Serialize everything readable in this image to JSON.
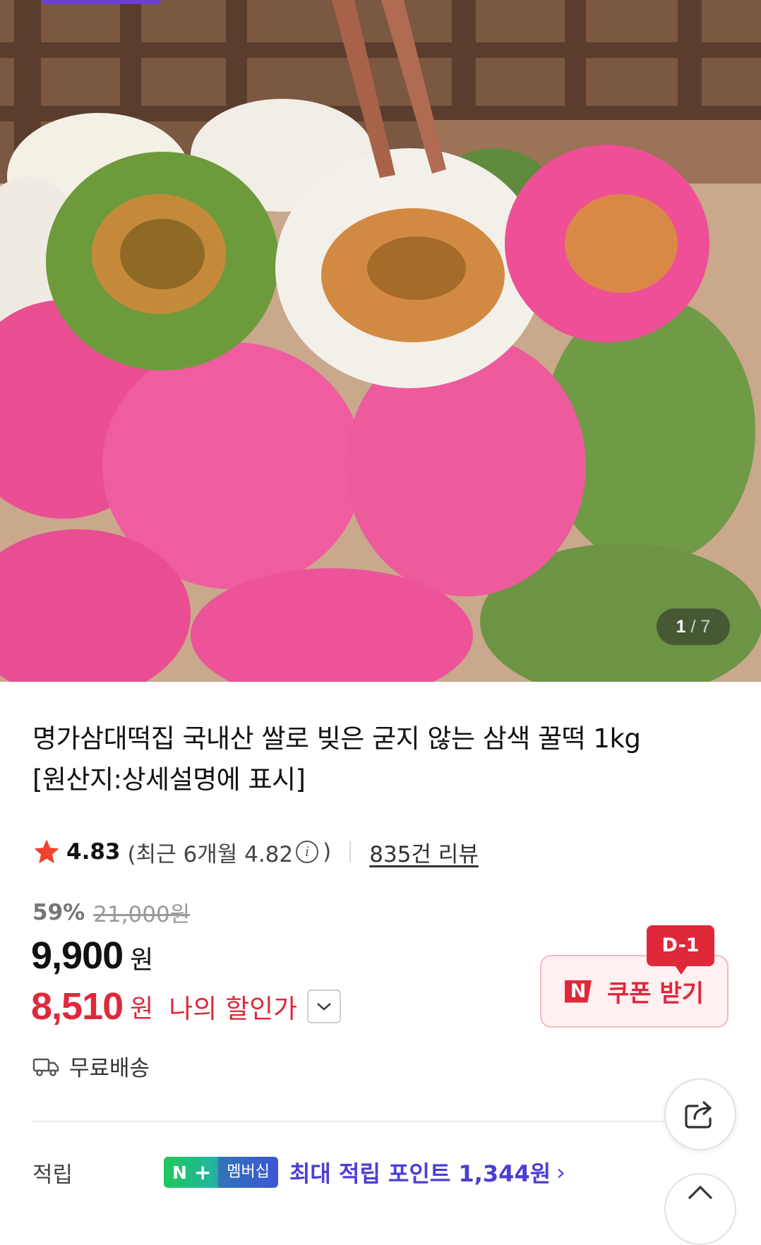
{
  "gallery": {
    "current": "1",
    "separator": "/",
    "total": "7"
  },
  "product": {
    "title_line1": "명가삼대떡집 국내산 쌀로 빚은 굳지 않는 삼색 꿀떡 1kg",
    "title_line2": "[원산지:상세설명에 표시]"
  },
  "rating": {
    "icon": "star-icon",
    "score": "4.83",
    "recent_prefix": "(최근 6개월 4.82",
    "recent_suffix": ")",
    "reviews": "835건 리뷰"
  },
  "price": {
    "discount_rate": "59%",
    "original": "21,000원",
    "sale": "9,900",
    "sale_unit": "원",
    "my_price": "8,510",
    "my_price_unit": "원",
    "my_price_label": "나의 할인가"
  },
  "coupon": {
    "badge": "D-1",
    "logo": "N",
    "label": "쿠폰 받기"
  },
  "shipping": {
    "icon": "truck-icon",
    "label": "무료배송"
  },
  "points": {
    "label": "적립",
    "badge_n": "N",
    "badge_plus": "+",
    "badge_text": "멤버십",
    "text": "최대 적립 포인트 1,344원",
    "chevron": "›"
  },
  "colors": {
    "accent_red": "#e0283b",
    "points_purple": "#4b3fd6",
    "coupon_bg": "#fff0f2"
  }
}
